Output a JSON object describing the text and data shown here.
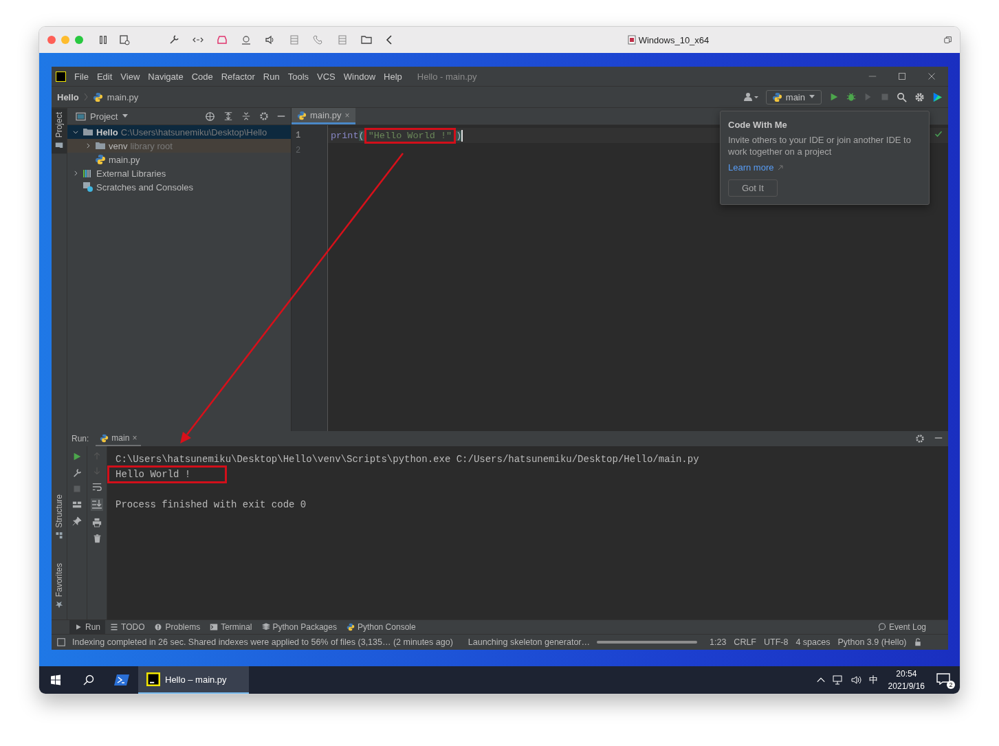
{
  "host_window": {
    "title": "Windows_10_x64"
  },
  "ide": {
    "menu": [
      {
        "label": "File"
      },
      {
        "label": "Edit"
      },
      {
        "label": "View"
      },
      {
        "label": "Navigate"
      },
      {
        "label": "Code"
      },
      {
        "label": "Refactor"
      },
      {
        "label": "Run"
      },
      {
        "label": "Tools"
      },
      {
        "label": "VCS"
      },
      {
        "label": "Window"
      },
      {
        "label": "Help"
      }
    ],
    "window_title": "Hello - main.py",
    "breadcrumb": [
      "Hello",
      "main.py"
    ],
    "run_configuration": "main",
    "tool_strip": [
      {
        "label": "Project",
        "selected": true
      },
      {
        "label": "Structure",
        "selected": false
      },
      {
        "label": "Favorites",
        "selected": false
      }
    ],
    "project_panel": {
      "title": "Project",
      "tree": [
        {
          "label": "Hello",
          "detail": "C:\\Users\\hatsunemiku\\Desktop\\Hello",
          "kind": "folder",
          "expanded": true,
          "selected": true,
          "children": [
            {
              "label": "venv",
              "detail": "library root",
              "kind": "library",
              "expanded": false,
              "selected": false
            },
            {
              "label": "main.py",
              "kind": "python",
              "selected": false
            }
          ]
        },
        {
          "label": "External Libraries",
          "kind": "libraries",
          "expanded": false,
          "selected": false
        },
        {
          "label": "Scratches and Consoles",
          "kind": "scratches",
          "selected": false
        }
      ]
    },
    "editor": {
      "tabs": [
        {
          "label": "main.py",
          "close": "×",
          "selected": true
        }
      ],
      "lines": [
        {
          "number": "1",
          "cursor": true,
          "code": [
            {
              "kind": "function",
              "text": "print"
            },
            {
              "kind": "paren",
              "text": "("
            },
            {
              "kind": "string",
              "text": "\"Hello World !\"",
              "highlighted": true
            },
            {
              "kind": "paren",
              "text": ")"
            }
          ]
        },
        {
          "number": "2",
          "cursor": false
        }
      ]
    },
    "popup": {
      "title": "Code With Me",
      "text": "Invite others to your IDE or join another IDE to work together on a project",
      "link": "Learn more",
      "button": "Got It"
    },
    "run_panel": {
      "label": "Run:",
      "tabs": [
        {
          "label": "main",
          "close": "×",
          "selected": true
        }
      ],
      "output": [
        {
          "kind": "command",
          "text": "C:\\Users\\hatsunemiku\\Desktop\\Hello\\venv\\Scripts\\python.exe C:/Users/hatsunemiku/Desktop/Hello/main.py",
          "highlighted": false
        },
        {
          "kind": "stdout",
          "text": "Hello World !",
          "highlighted": true
        },
        {
          "kind": "exit",
          "text": "Process finished with exit code 0",
          "highlighted": false
        }
      ]
    },
    "tool_tabs": [
      {
        "label": "Run",
        "kind": "run",
        "selected": true
      },
      {
        "label": "TODO",
        "kind": "todo",
        "selected": false
      },
      {
        "label": "Problems",
        "kind": "problems",
        "selected": false
      },
      {
        "label": "Terminal",
        "kind": "terminal",
        "selected": false
      },
      {
        "label": "Python Packages",
        "kind": "packages",
        "selected": false
      },
      {
        "label": "Python Console",
        "kind": "console",
        "selected": false
      }
    ],
    "event_log": "Event Log",
    "status_bar": {
      "message": "Indexing completed in 26 sec. Shared indexes were applied to 56% of files (3,135… (2 minutes ago)",
      "task": "Launching skeleton generator…",
      "level": 1,
      "items": [
        "1:23",
        "CRLF",
        "UTF-8",
        "4 spaces",
        "Python 3.9 (Hello)"
      ]
    }
  },
  "taskbar": {
    "apps": [
      {
        "label": "Hello – main.py",
        "selected": true
      }
    ],
    "input_method": "中",
    "time": "20:54",
    "date": "2021/9/16",
    "notifications": "2"
  }
}
